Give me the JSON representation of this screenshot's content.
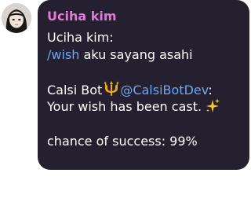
{
  "message": {
    "sender_name": "Uciha kim",
    "quoted_author": "Uciha kim:",
    "command": "/wish",
    "command_text": " aku sayang asahi",
    "bot_name": "Calsi Bot",
    "bot_handle": "@CalsiBotDev",
    "bot_handle_suffix": ":",
    "result_text": "Your wish has been cast.",
    "chance_text": "chance of success: 99%"
  },
  "colors": {
    "bubble_background": "#25202f",
    "sender_name": "#e07ad6",
    "link": "#6fa6f2",
    "text": "#ffffff"
  },
  "icons": {
    "avatar": "user-avatar-photo",
    "bot_emoji": "trident-icon",
    "result_emoji": "sparkles-icon"
  }
}
